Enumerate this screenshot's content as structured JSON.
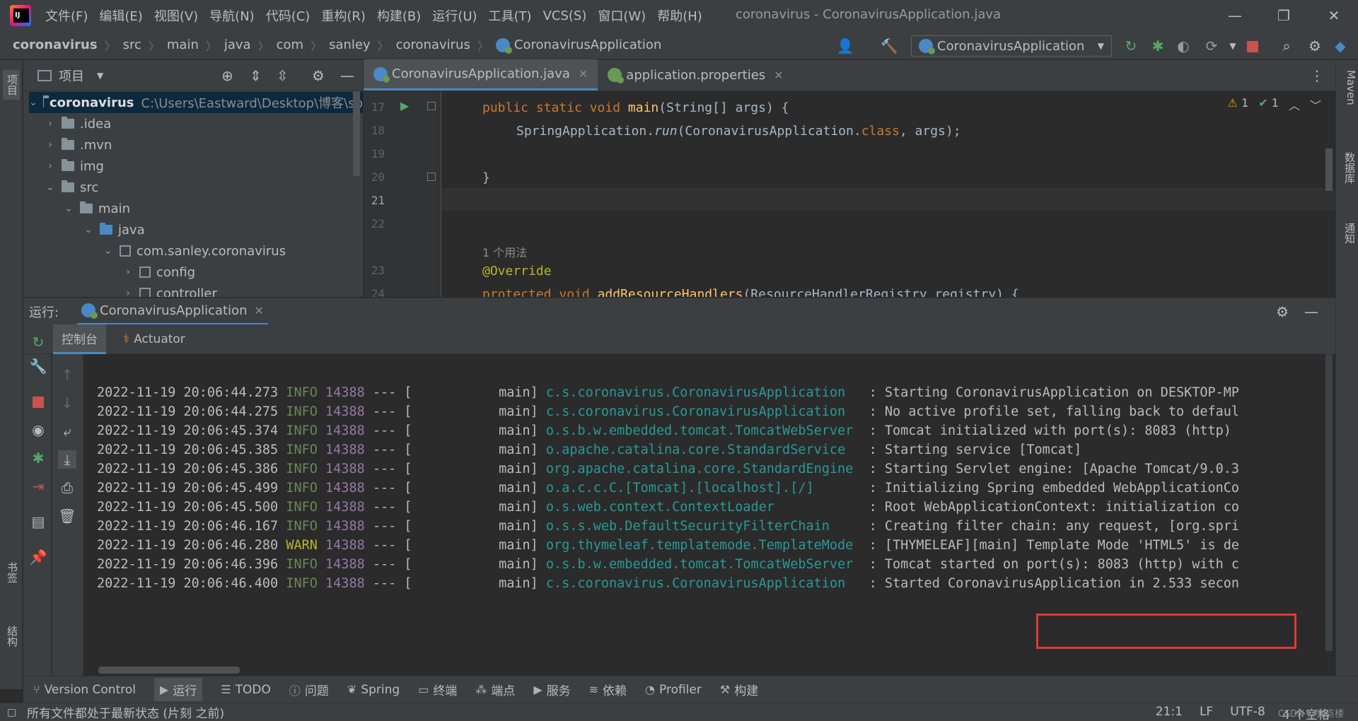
{
  "menu": {
    "items": [
      "文件(F)",
      "编辑(E)",
      "视图(V)",
      "导航(N)",
      "代码(C)",
      "重构(R)",
      "构建(B)",
      "运行(U)",
      "工具(T)",
      "VCS(S)",
      "窗口(W)",
      "帮助(H)"
    ],
    "window_title": "coronavirus - CoronavirusApplication.java"
  },
  "breadcrumb": {
    "items": [
      "coronavirus",
      "src",
      "main",
      "java",
      "com",
      "sanley",
      "coronavirus"
    ],
    "current": "CoronavirusApplication"
  },
  "run_config": {
    "selected": "CoronavirusApplication"
  },
  "project_panel": {
    "title": "项目",
    "tree": [
      {
        "label": "coronavirus",
        "extra": "C:\\Users\\Eastward\\Desktop\\博客\\sp",
        "type": "module"
      },
      {
        "label": ".idea",
        "type": "folder"
      },
      {
        "label": ".mvn",
        "type": "folder"
      },
      {
        "label": "img",
        "type": "folder"
      },
      {
        "label": "src",
        "type": "folder"
      },
      {
        "label": "main",
        "type": "folder"
      },
      {
        "label": "java",
        "type": "source"
      },
      {
        "label": "com.sanley.coronavirus",
        "type": "package"
      },
      {
        "label": "config",
        "type": "package"
      },
      {
        "label": "controller",
        "type": "package"
      }
    ]
  },
  "left_strip": {
    "top_tab": "项目",
    "bookmarks_tab": "书签",
    "structure_tab": "结构"
  },
  "right_strip": {
    "maven_tab": "Maven",
    "database_tab": "数据库",
    "notifications_tab": "通知"
  },
  "editor": {
    "tabs": [
      {
        "label": "CoronavirusApplication.java",
        "active": true
      },
      {
        "label": "application.properties",
        "active": false
      }
    ],
    "warnings": "1",
    "checks": "1",
    "lines": [
      {
        "n": "17"
      },
      {
        "n": "18"
      },
      {
        "n": "19"
      },
      {
        "n": "20"
      },
      {
        "n": "21"
      },
      {
        "n": "22"
      },
      {
        "n": "23"
      },
      {
        "n": "24"
      }
    ],
    "code": {
      "l17_kw": "public static void ",
      "l17_fn": "main",
      "l17_rest": "(String[] args) {",
      "l18_a": "SpringApplication.",
      "l18_run": "run",
      "l18_b": "(CoronavirusApplication.",
      "l18_class": "class",
      "l18_c": ", args);",
      "l20": "}",
      "usage_hint": "1 个用法",
      "l23": "@Override",
      "l24_kw": "protected void ",
      "l24_fn": "addResourceHandlers",
      "l24_rest": "(ResourceHandlerRegistry registry) {"
    }
  },
  "run_panel": {
    "label": "运行:",
    "tab": "CoronavirusApplication",
    "subtabs": [
      "控制台",
      "Actuator"
    ]
  },
  "console": {
    "logs": [
      {
        "ts": "2022-11-19 20:06:44.273",
        "level": "INFO",
        "pid": "14388",
        "thread": "--- [           main]",
        "logger": "c.s.coronavirus.CoronavirusApplication  ",
        "msg": " : Starting CoronavirusApplication on DESKTOP-MP"
      },
      {
        "ts": "2022-11-19 20:06:44.275",
        "level": "INFO",
        "pid": "14388",
        "thread": "--- [           main]",
        "logger": "c.s.coronavirus.CoronavirusApplication  ",
        "msg": " : No active profile set, falling back to defaul"
      },
      {
        "ts": "2022-11-19 20:06:45.374",
        "level": "INFO",
        "pid": "14388",
        "thread": "--- [           main]",
        "logger": "o.s.b.w.embedded.tomcat.TomcatWebServer ",
        "msg": " : Tomcat initialized with port(s): 8083 (http)"
      },
      {
        "ts": "2022-11-19 20:06:45.385",
        "level": "INFO",
        "pid": "14388",
        "thread": "--- [           main]",
        "logger": "o.apache.catalina.core.StandardService  ",
        "msg": " : Starting service [Tomcat]"
      },
      {
        "ts": "2022-11-19 20:06:45.386",
        "level": "INFO",
        "pid": "14388",
        "thread": "--- [           main]",
        "logger": "org.apache.catalina.core.StandardEngine ",
        "msg": " : Starting Servlet engine: [Apache Tomcat/9.0.3"
      },
      {
        "ts": "2022-11-19 20:06:45.499",
        "level": "INFO",
        "pid": "14388",
        "thread": "--- [           main]",
        "logger": "o.a.c.c.C.[Tomcat].[localhost].[/]      ",
        "msg": " : Initializing Spring embedded WebApplicationCo"
      },
      {
        "ts": "2022-11-19 20:06:45.500",
        "level": "INFO",
        "pid": "14388",
        "thread": "--- [           main]",
        "logger": "o.s.web.context.ContextLoader           ",
        "msg": " : Root WebApplicationContext: initialization co"
      },
      {
        "ts": "2022-11-19 20:06:46.167",
        "level": "INFO",
        "pid": "14388",
        "thread": "--- [           main]",
        "logger": "o.s.s.web.DefaultSecurityFilterChain    ",
        "msg": " : Creating filter chain: any request, [org.spri"
      },
      {
        "ts": "2022-11-19 20:06:46.280",
        "level": "WARN",
        "pid": "14388",
        "thread": "--- [           main]",
        "logger": "org.thymeleaf.templatemode.TemplateMode ",
        "msg": " : [THYMELEAF][main] Template Mode 'HTML5' is de"
      },
      {
        "ts": "2022-11-19 20:06:46.396",
        "level": "INFO",
        "pid": "14388",
        "thread": "--- [           main]",
        "logger": "o.s.b.w.embedded.tomcat.TomcatWebServer ",
        "msg": " : Tomcat started on port(s): 8083 (http) with c"
      },
      {
        "ts": "2022-11-19 20:06:46.400",
        "level": "INFO",
        "pid": "14388",
        "thread": "--- [           main]",
        "logger": "c.s.coronavirus.CoronavirusApplication  ",
        "msg": " : Started CoronavirusApplication in 2.533 secon"
      }
    ]
  },
  "bottom_tools": [
    {
      "label": "Version Control",
      "icon": "branch-icon"
    },
    {
      "label": "运行",
      "icon": "play-icon",
      "active": true
    },
    {
      "label": "TODO",
      "icon": "list-icon"
    },
    {
      "label": "问题",
      "icon": "info-icon"
    },
    {
      "label": "Spring",
      "icon": "spring-icon"
    },
    {
      "label": "终端",
      "icon": "terminal-icon"
    },
    {
      "label": "端点",
      "icon": "endpoints-icon"
    },
    {
      "label": "服务",
      "icon": "services-icon"
    },
    {
      "label": "依赖",
      "icon": "layers-icon"
    },
    {
      "label": "Profiler",
      "icon": "profiler-icon"
    },
    {
      "label": "构建",
      "icon": "hammer-icon"
    }
  ],
  "status": {
    "message": "所有文件都处于最新状态 (片刻 之前)",
    "position": "21:1",
    "line_sep": "LF",
    "encoding": "UTF-8",
    "indent": "4 个空格",
    "watermark": "CSDN @亮点楼"
  }
}
